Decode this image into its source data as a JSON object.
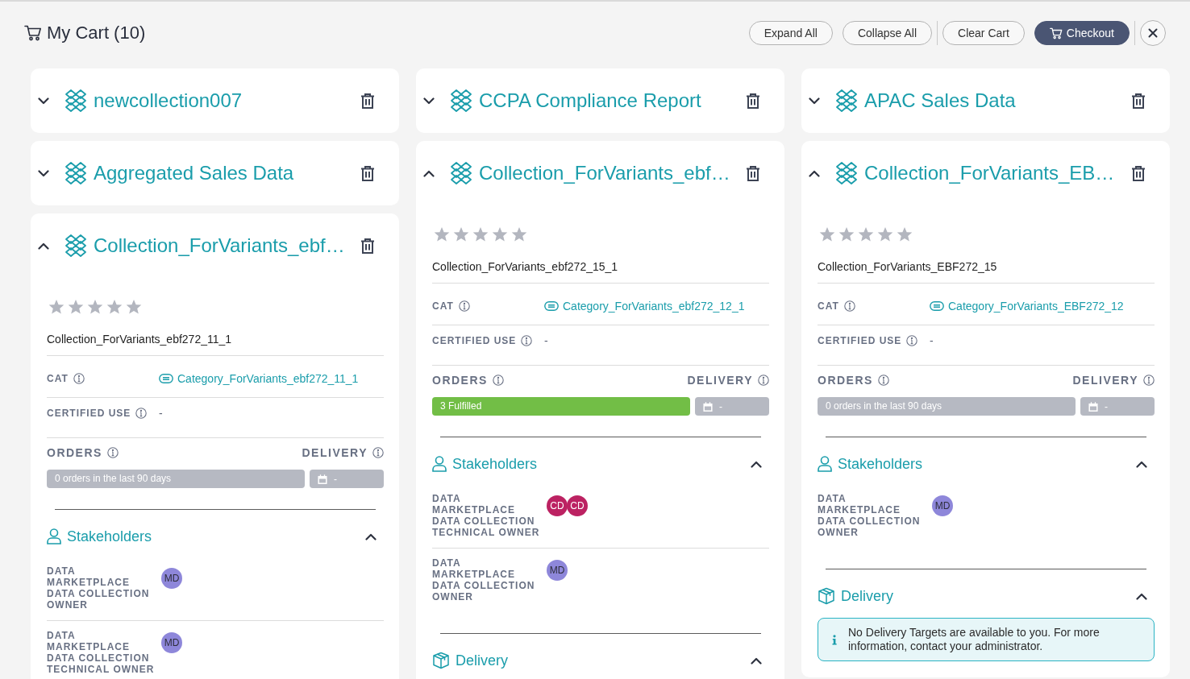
{
  "header": {
    "title": "My Cart (10)",
    "button_groups": [
      [
        {
          "label": "Expand All",
          "kind": "outline"
        },
        {
          "label": "Collapse All",
          "kind": "outline"
        }
      ],
      [
        {
          "label": "Clear Cart",
          "kind": "outline"
        },
        {
          "label": "Checkout",
          "kind": "primary"
        }
      ]
    ]
  },
  "columns": [
    {
      "cards": [
        {
          "title": "newcollection007",
          "expanded": false
        },
        {
          "title": "Aggregated Sales Data",
          "expanded": false
        },
        {
          "title": "Collection_ForVariants_ebf…",
          "expanded": true,
          "stars": 0,
          "name": "Collection_ForVariants_ebf272_11_1",
          "fields": [
            {
              "label": "CAT",
              "kind": "link",
              "value": "Category_ForVariants_ebf272_11_1"
            },
            {
              "label": "CERTIFIED USE",
              "kind": "text",
              "value": "-"
            }
          ],
          "orders": {
            "label": "ORDERS",
            "kind": "empty",
            "text": "0 orders in the last 90 days"
          },
          "delivery_status": {
            "label": "DELIVERY",
            "value": "-"
          },
          "stakeholders": {
            "title": "Stakeholders",
            "expanded": true,
            "rows": [
              {
                "role": "DATA MARKETPLACE DATA COLLECTION OWNER",
                "avatars": [
                  {
                    "initials": "MD",
                    "color": "#8e87da"
                  }
                ]
              },
              {
                "role": "DATA MARKETPLACE DATA COLLECTION TECHNICAL OWNER",
                "avatars": [
                  {
                    "initials": "MD",
                    "color": "#8e87da"
                  }
                ]
              }
            ]
          }
        }
      ]
    },
    {
      "cards": [
        {
          "title": "CCPA Compliance Report",
          "expanded": false
        },
        {
          "title": "Collection_ForVariants_ebf…",
          "expanded": true,
          "stars": 0,
          "name": "Collection_ForVariants_ebf272_15_1",
          "fields": [
            {
              "label": "CAT",
              "kind": "link",
              "value": "Category_ForVariants_ebf272_12_1"
            },
            {
              "label": "CERTIFIED USE",
              "kind": "text",
              "value": "-"
            }
          ],
          "orders": {
            "label": "ORDERS",
            "kind": "fulfilled",
            "text": "3 Fulfilled"
          },
          "delivery_status": {
            "label": "DELIVERY",
            "value": "-"
          },
          "stakeholders": {
            "title": "Stakeholders",
            "expanded": true,
            "rows": [
              {
                "role": "DATA MARKETPLACE DATA COLLECTION TECHNICAL OWNER",
                "avatars": [
                  {
                    "initials": "CD",
                    "color": "#bc2262"
                  },
                  {
                    "initials": "CD",
                    "color": "#bc2262"
                  }
                ]
              },
              {
                "role": "DATA MARKETPLACE DATA COLLECTION OWNER",
                "avatars": [
                  {
                    "initials": "MD",
                    "color": "#8e87da"
                  }
                ]
              }
            ]
          },
          "delivery": {
            "title": "Delivery",
            "expanded": true
          }
        }
      ]
    },
    {
      "cards": [
        {
          "title": "APAC Sales Data",
          "expanded": false
        },
        {
          "title": "Collection_ForVariants_EB…",
          "expanded": true,
          "stars": 0,
          "name": "Collection_ForVariants_EBF272_15",
          "fields": [
            {
              "label": "CAT",
              "kind": "link",
              "value": "Category_ForVariants_EBF272_12"
            },
            {
              "label": "CERTIFIED USE",
              "kind": "text",
              "value": "-"
            }
          ],
          "orders": {
            "label": "ORDERS",
            "kind": "empty",
            "text": "0 orders in the last 90 days"
          },
          "delivery_status": {
            "label": "DELIVERY",
            "value": "-"
          },
          "stakeholders": {
            "title": "Stakeholders",
            "expanded": true,
            "rows": [
              {
                "role": "DATA MARKETPLACE DATA COLLECTION OWNER",
                "avatars": [
                  {
                    "initials": "MD",
                    "color": "#8e87da"
                  }
                ]
              }
            ]
          },
          "delivery": {
            "title": "Delivery",
            "expanded": true,
            "message": "No Delivery Targets are available to you. For more information, contact your administrator."
          }
        }
      ]
    }
  ]
}
